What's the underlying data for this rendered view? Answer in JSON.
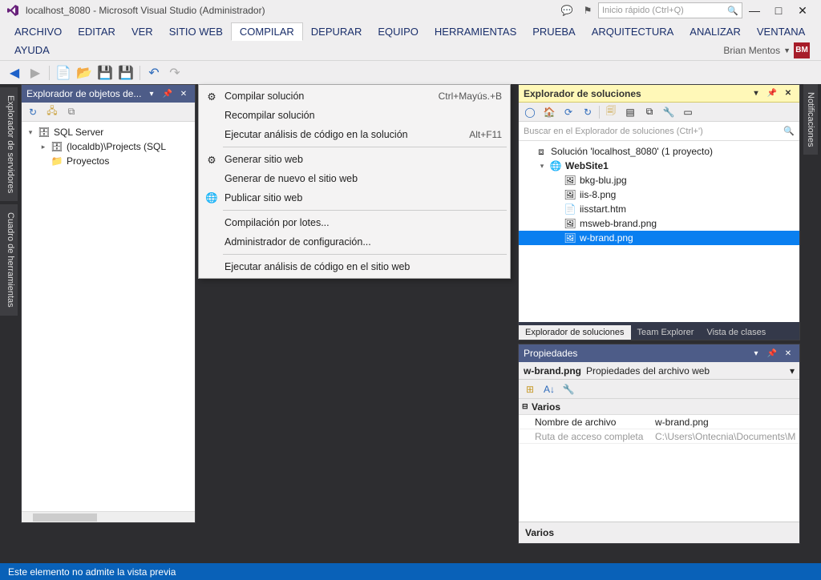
{
  "titlebar": {
    "title": "localhost_8080 - Microsoft Visual Studio (Administrador)",
    "quicksearch_placeholder": "Inicio rápido (Ctrl+Q)"
  },
  "menu": {
    "items": [
      "ARCHIVO",
      "EDITAR",
      "VER",
      "SITIO WEB",
      "COMPILAR",
      "DEPURAR",
      "EQUIPO",
      "HERRAMIENTAS",
      "PRUEBA",
      "ARQUITECTURA",
      "ANALIZAR",
      "VENTANA",
      "AYUDA"
    ],
    "active_index": 4,
    "user": "Brian Mentos",
    "avatar": "BM"
  },
  "dropdown": {
    "groups": [
      [
        {
          "icon": "build",
          "label": "Compilar solución",
          "shortcut": "Ctrl+Mayús.+B"
        },
        {
          "icon": "",
          "label": "Recompilar solución",
          "shortcut": ""
        },
        {
          "icon": "",
          "label": "Ejecutar análisis de código en la solución",
          "shortcut": "Alt+F11"
        }
      ],
      [
        {
          "icon": "gen",
          "label": "Generar sitio web",
          "shortcut": ""
        },
        {
          "icon": "",
          "label": "Generar de nuevo el sitio web",
          "shortcut": ""
        },
        {
          "icon": "pub",
          "label": "Publicar sitio web",
          "shortcut": ""
        }
      ],
      [
        {
          "icon": "",
          "label": "Compilación por lotes...",
          "shortcut": ""
        },
        {
          "icon": "",
          "label": "Administrador de configuración...",
          "shortcut": ""
        }
      ],
      [
        {
          "icon": "",
          "label": "Ejecutar análisis de código en el sitio web",
          "shortcut": ""
        }
      ]
    ]
  },
  "server_explorer": {
    "title": "Explorador de objetos de...",
    "nodes": [
      {
        "indent": 0,
        "arrow": "▾",
        "icon": "db",
        "label": "SQL Server"
      },
      {
        "indent": 1,
        "arrow": "▸",
        "icon": "db",
        "label": "(localdb)\\Projects (SQL"
      },
      {
        "indent": 1,
        "arrow": "",
        "icon": "folder",
        "label": "Proyectos"
      }
    ]
  },
  "solution_explorer": {
    "title": "Explorador de soluciones",
    "search_placeholder": "Buscar en el Explorador de soluciones (Ctrl+')",
    "nodes": [
      {
        "indent": 0,
        "arrow": "",
        "icon": "sln",
        "label": "Solución 'localhost_8080' (1 proyecto)",
        "selected": false,
        "bold": false
      },
      {
        "indent": 1,
        "arrow": "▾",
        "icon": "globe",
        "label": "WebSite1",
        "selected": false,
        "bold": true
      },
      {
        "indent": 2,
        "arrow": "",
        "icon": "img",
        "label": "bkg-blu.jpg",
        "selected": false,
        "bold": false
      },
      {
        "indent": 2,
        "arrow": "",
        "icon": "img",
        "label": "iis-8.png",
        "selected": false,
        "bold": false
      },
      {
        "indent": 2,
        "arrow": "",
        "icon": "htm",
        "label": "iisstart.htm",
        "selected": false,
        "bold": false
      },
      {
        "indent": 2,
        "arrow": "",
        "icon": "img",
        "label": "msweb-brand.png",
        "selected": false,
        "bold": false
      },
      {
        "indent": 2,
        "arrow": "",
        "icon": "img",
        "label": "w-brand.png",
        "selected": true,
        "bold": false
      }
    ],
    "tabs": [
      "Explorador de soluciones",
      "Team Explorer",
      "Vista de clases"
    ],
    "active_tab": 0
  },
  "properties": {
    "title": "Propiedades",
    "object_name": "w-brand.png",
    "object_type": "Propiedades del archivo web",
    "category": "Varios",
    "rows": [
      {
        "name": "Nombre de archivo",
        "value": "w-brand.png",
        "dim": false
      },
      {
        "name": "Ruta de acceso completa",
        "value": "C:\\Users\\Ontecnia\\Documents\\M",
        "dim": true
      }
    ],
    "desc_title": "Varios",
    "desc_body": ""
  },
  "left_tabs": [
    "Explorador de servidores",
    "Cuadro de herramientas"
  ],
  "right_tabs": [
    "Notificaciones"
  ],
  "statusbar": "Este elemento no admite la vista previa"
}
